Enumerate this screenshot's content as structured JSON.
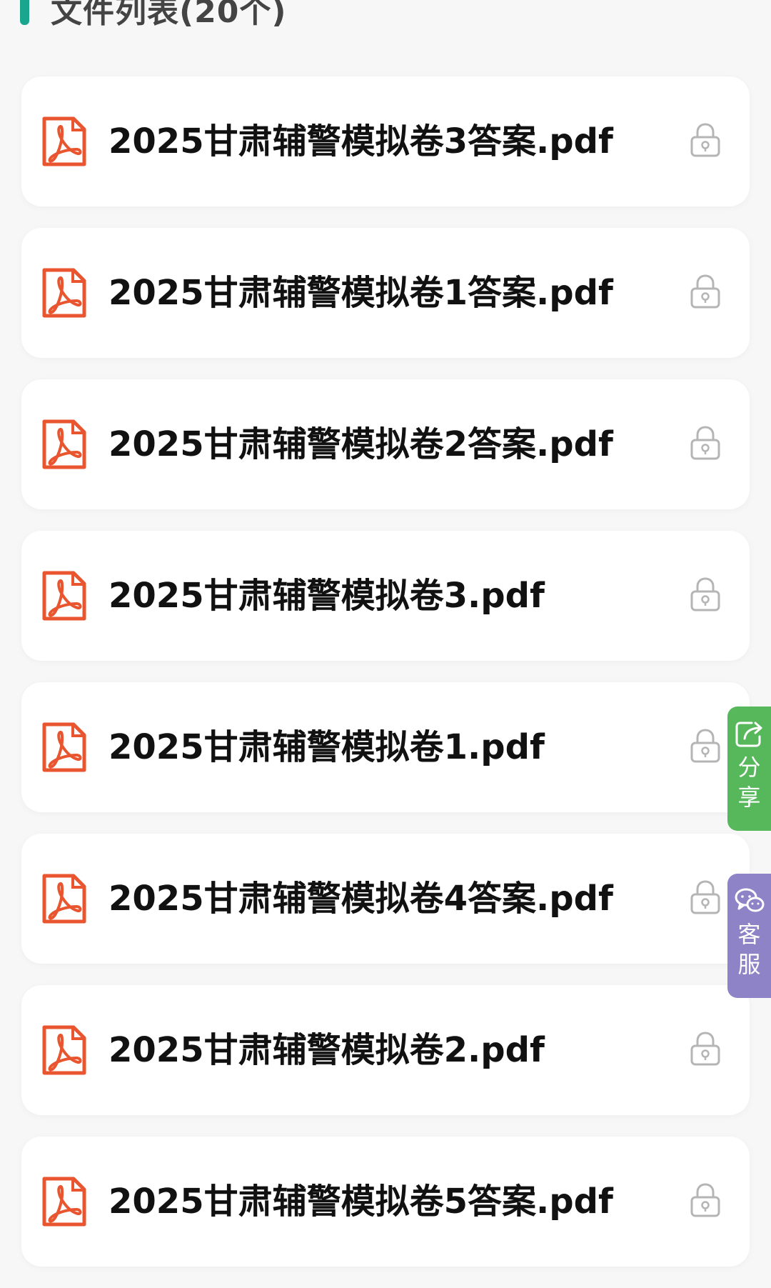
{
  "header": {
    "title": "文件列表(20个)",
    "accent_color": "#1aa58f"
  },
  "files": [
    {
      "name": "2025甘肃辅警模拟卷3答案.pdf",
      "icon": "pdf-icon",
      "status_icon": "lock-icon"
    },
    {
      "name": "2025甘肃辅警模拟卷1答案.pdf",
      "icon": "pdf-icon",
      "status_icon": "lock-icon"
    },
    {
      "name": "2025甘肃辅警模拟卷2答案.pdf",
      "icon": "pdf-icon",
      "status_icon": "lock-icon"
    },
    {
      "name": "2025甘肃辅警模拟卷3.pdf",
      "icon": "pdf-icon",
      "status_icon": "lock-icon"
    },
    {
      "name": "2025甘肃辅警模拟卷1.pdf",
      "icon": "pdf-icon",
      "status_icon": "lock-icon"
    },
    {
      "name": "2025甘肃辅警模拟卷4答案.pdf",
      "icon": "pdf-icon",
      "status_icon": "lock-icon"
    },
    {
      "name": "2025甘肃辅警模拟卷2.pdf",
      "icon": "pdf-icon",
      "status_icon": "lock-icon"
    },
    {
      "name": "2025甘肃辅警模拟卷5答案.pdf",
      "icon": "pdf-icon",
      "status_icon": "lock-icon"
    }
  ],
  "floating": {
    "share": {
      "label": "分享",
      "icon": "share-icon",
      "color": "#57b85b"
    },
    "service": {
      "label": "客服",
      "icon": "wechat-icon",
      "color": "#8e83c6"
    }
  },
  "colors": {
    "pdf": "#e8552f",
    "lock": "#b5b5b5"
  }
}
